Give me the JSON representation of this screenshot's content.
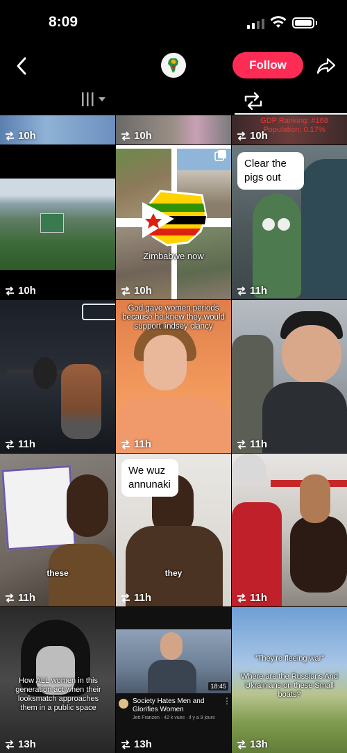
{
  "status_bar": {
    "time": "8:09"
  },
  "header": {
    "follow_label": "Follow",
    "back_icon": "back-chevron-icon",
    "share_icon": "share-arrow-icon"
  },
  "tabs": [
    {
      "icon": "grid-icon"
    },
    {
      "icon": "repost-icon"
    }
  ],
  "videos": [
    {
      "views": "10h",
      "caption": ""
    },
    {
      "views": "10h",
      "caption": ""
    },
    {
      "views": "10h",
      "caption": "GDP Ranking: #168  Population: 0.17%"
    },
    {
      "views": "10h",
      "caption": ""
    },
    {
      "views": "10h",
      "caption": "Zimbabwe now"
    },
    {
      "views": "11h",
      "caption": "Clear the pigs out"
    },
    {
      "views": "11h",
      "caption": ""
    },
    {
      "views": "11h",
      "caption": "God gave women periods because he knew they would support lindsey clancy"
    },
    {
      "views": "11h",
      "caption": ""
    },
    {
      "views": "11h",
      "caption": "these"
    },
    {
      "views": "11h",
      "caption": "We wuz annunaki",
      "caption2": "they"
    },
    {
      "views": "11h",
      "caption": ""
    },
    {
      "views": "13h",
      "caption": "How ALL women in this generation act when their looksmatch approaches them in a public space"
    },
    {
      "views": "13h",
      "caption": "Society Hates Men and Glorifies Women",
      "meta": "Jett Franzen · 42 k vues · il y a 9 jours",
      "duration": "18:45"
    },
    {
      "views": "13h",
      "caption": "\"They're fleeing war\"",
      "caption2": "Where are the Russians And Ukrainians on these Small boats?"
    }
  ]
}
